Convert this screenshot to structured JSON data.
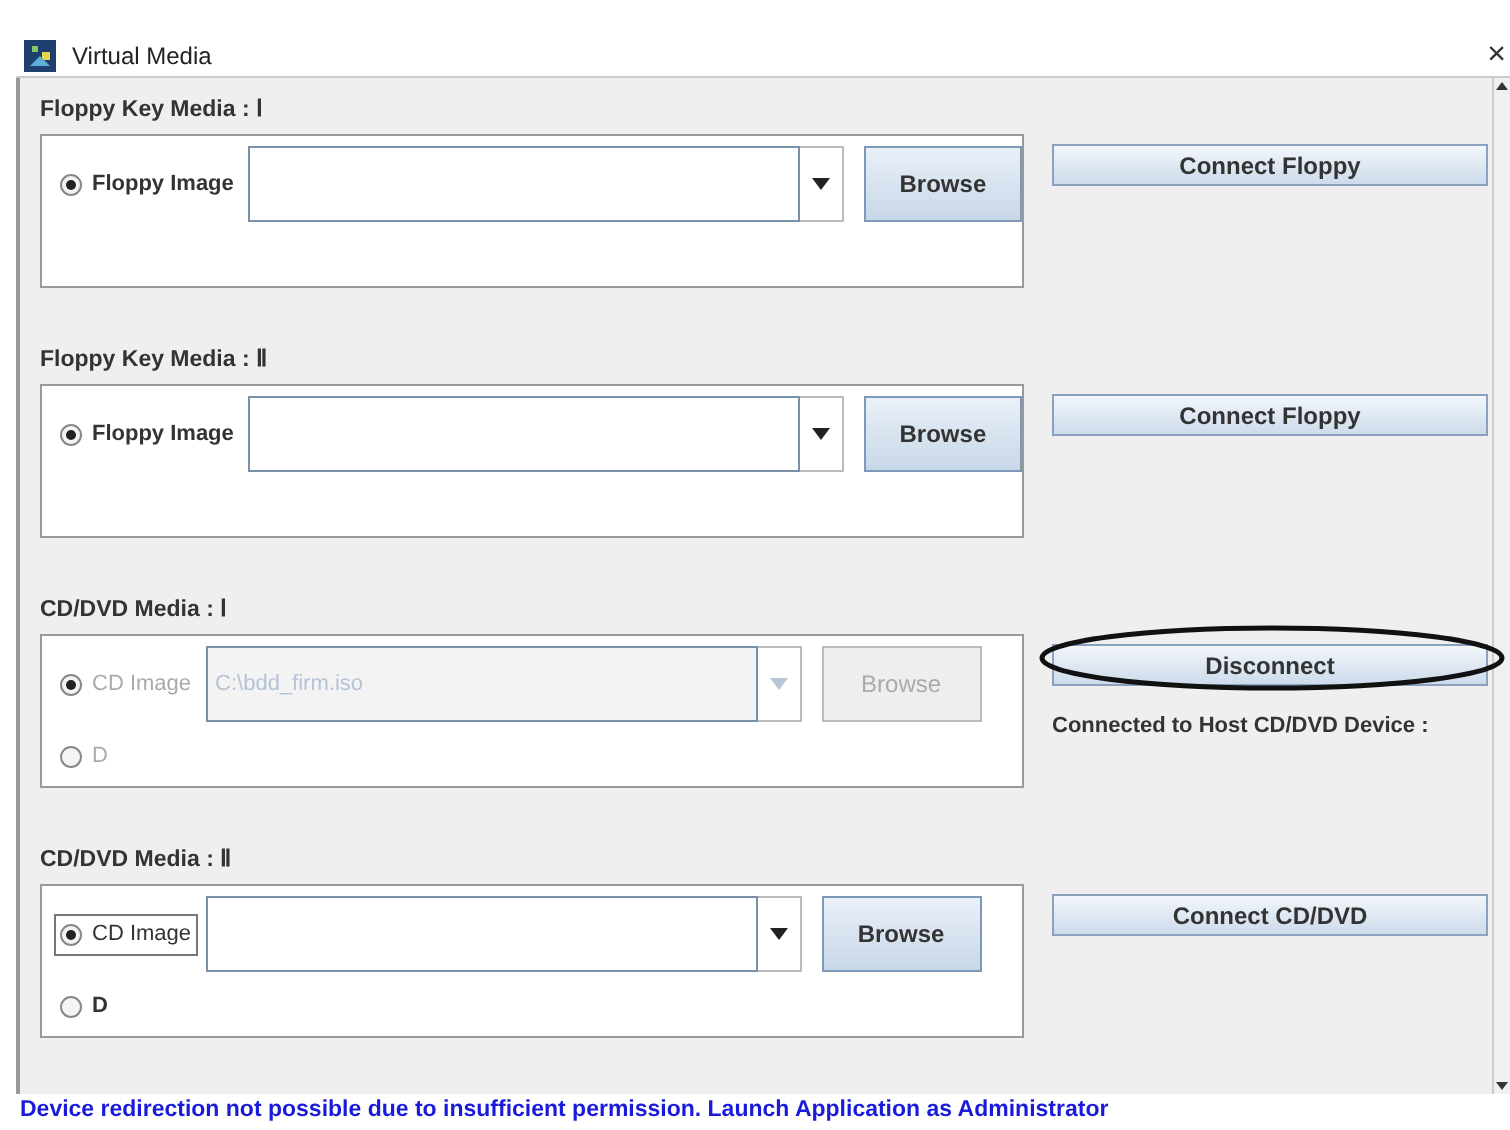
{
  "window": {
    "title": "Virtual Media",
    "close": "×"
  },
  "sections": [
    {
      "title": "Floppy Key Media : Ⅰ",
      "disabled": false,
      "options": [
        {
          "kind": "image",
          "label": "Floppy Image",
          "selected": true,
          "focused": false
        }
      ],
      "browse": "Browse",
      "action": {
        "label": "Connect Floppy",
        "circled": false
      }
    },
    {
      "title": "Floppy Key Media : Ⅱ",
      "disabled": false,
      "options": [
        {
          "kind": "image",
          "label": "Floppy Image",
          "selected": true,
          "focused": false
        }
      ],
      "browse": "Browse",
      "action": {
        "label": "Connect Floppy",
        "circled": false
      }
    },
    {
      "title": "CD/DVD Media : Ⅰ",
      "disabled": true,
      "options": [
        {
          "kind": "image",
          "label": "CD Image",
          "selected": true,
          "focused": false,
          "value": "C:\\bdd_firm.iso"
        },
        {
          "kind": "drive",
          "label": "D",
          "selected": false,
          "focused": false
        }
      ],
      "browse": "Browse",
      "action": {
        "label": "Disconnect",
        "circled": true
      },
      "status": "Connected to Host CD/DVD Device :"
    },
    {
      "title": "CD/DVD Media : Ⅱ",
      "disabled": false,
      "options": [
        {
          "kind": "image",
          "label": "CD Image",
          "selected": true,
          "focused": true
        },
        {
          "kind": "drive",
          "label": "D",
          "selected": false,
          "focused": false
        }
      ],
      "browse": "Browse",
      "action": {
        "label": "Connect CD/DVD",
        "circled": false
      }
    }
  ],
  "status_bar": "Device redirection not possible due to insufficient permission. Launch Application as Administrator"
}
